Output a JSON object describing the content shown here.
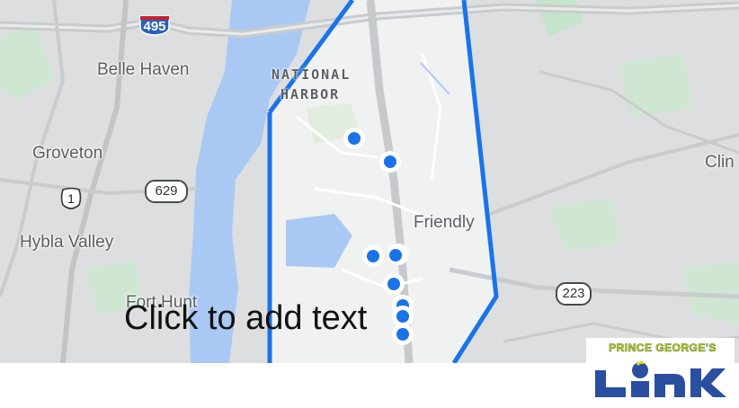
{
  "map": {
    "places": {
      "belle_haven": "Belle Haven",
      "national_harbor_line1": "NATIONAL",
      "national_harbor_line2": "HARBOR",
      "groveton": "Groveton",
      "friendly": "Friendly",
      "hybla_valley": "Hybla Valley",
      "fort_hunt": "Fort Hunt",
      "clinton_partial": "Clin"
    },
    "shields": {
      "interstate": "495",
      "us_route": "1",
      "route_629": "629",
      "route_223": "223"
    },
    "colors": {
      "boundary": "#1a73e8",
      "stop_marker": "#1a73e8",
      "water": "#aac8f4",
      "park": "#c5e4cb",
      "inside_zone": "#f1f2f2",
      "outside_zone": "#dcdedf"
    },
    "stop_marker_count": 9
  },
  "slide": {
    "placeholder_text": "Click to add text"
  },
  "logo": {
    "top_text": "PRINCE GEORGE'S",
    "wordmark": "LINK"
  }
}
